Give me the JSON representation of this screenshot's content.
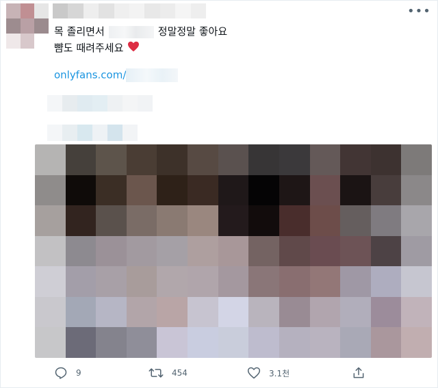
{
  "tweet": {
    "text_line1_start": "목 졸리면서",
    "text_line1_end": "정말정말 좋아요",
    "text_line2": "뺨도 때려주세요",
    "link_prefix": "onlyfans.com/"
  },
  "actions": {
    "reply_count": "9",
    "retweet_count": "454",
    "like_count": "3.1천"
  },
  "avatar_colors": [
    "#c7b3b6",
    "#c08f93",
    "#e6e6e6",
    "#9d8c8f",
    "#b9a0a5",
    "#9b8b8e",
    "#efe8e9",
    "#d8c8cb",
    "#ffffff"
  ],
  "name_colors": [
    "#c9c9c9",
    "#d6d6d6",
    "#eeeeee",
    "#e2e2e2",
    "#efefef",
    "#f3f3f3",
    "#e8e8e8",
    "#ececec",
    "#f5f5f5",
    "#eeeeee"
  ],
  "mosaic_row1_colors": [
    "#f4f6f8",
    "#e7ecef",
    "#e0ebf1",
    "#e3eef3",
    "#eef1f3",
    "#f4f5f6",
    "#f1f3f5",
    "#ffffff"
  ],
  "mosaic_row2_colors": [
    "#f4f6f8",
    "#e8eef1",
    "#d8e8ef",
    "#eef2f5",
    "#d4e4ed",
    "#f2f4f6",
    "#ffffff",
    "#ffffff"
  ],
  "media_colors": [
    [
      "#b5b4b3",
      "#45403b",
      "#5d544b",
      "#4a3d34",
      "#3d3129",
      "#574a43",
      "#5a514f",
      "#373536",
      "#3b393b",
      "#645958",
      "#423534",
      "#3d3230",
      "#7d7a79"
    ],
    [
      "#8f8c8b",
      "#0f0b09",
      "#3b2e25",
      "#6b564d",
      "#2e2118",
      "#3a2a23",
      "#1f1819",
      "#050405",
      "#1e1616",
      "#6b4f50",
      "#1b1414",
      "#483d3c",
      "#8b8889"
    ],
    [
      "#a6a09e",
      "#32241f",
      "#5a514c",
      "#7a6c66",
      "#8a7a72",
      "#9a877f",
      "#231a1c",
      "#120c0c",
      "#492d2c",
      "#6d4d4a",
      "#655e5e",
      "#7f7b80",
      "#a8a6ab"
    ],
    [
      "#c2c1c3",
      "#8d8a90",
      "#9b9198",
      "#a29aa0",
      "#a5a0a6",
      "#ae9f9f",
      "#a89799",
      "#746362",
      "#60494a",
      "#6a4c51",
      "#6d5356",
      "#4d4245",
      "#9f9ba3"
    ],
    [
      "#cfced5",
      "#a39ea9",
      "#a8a0a7",
      "#a89c9b",
      "#b1a7ab",
      "#b0a5ab",
      "#a4989f",
      "#8a7678",
      "#896e70",
      "#937777",
      "#9f98a5",
      "#aeadbf",
      "#c6c6d0"
    ],
    [
      "#c9c8cd",
      "#a3a8b6",
      "#b6b6c5",
      "#b2a5a9",
      "#b9a5a6",
      "#c7c4d0",
      "#d3d5e6",
      "#b9b4bd",
      "#998b94",
      "#b1a5ae",
      "#b1aebb",
      "#9c8c9b",
      "#c1b3ba"
    ],
    [
      "#c7c7c9",
      "#6c6b78",
      "#84838d",
      "#8f8e99",
      "#c9c5d6",
      "#c9cde0",
      "#c9cddb",
      "#bebcce",
      "#b5b1bf",
      "#b9b3bf",
      "#a9a9b6",
      "#aa979d",
      "#c1aeb0"
    ]
  ]
}
